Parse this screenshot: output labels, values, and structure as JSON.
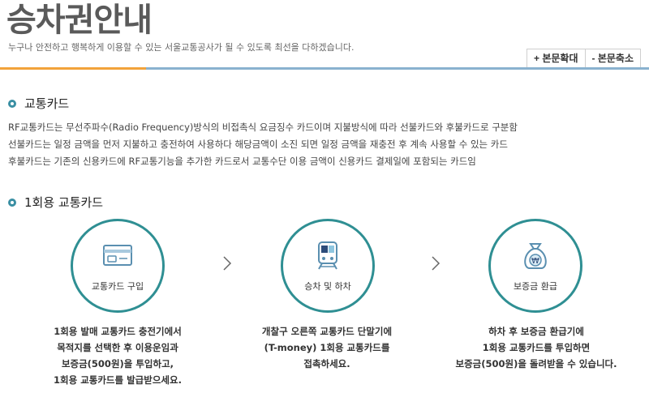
{
  "header": {
    "title": "승차권안내",
    "subtitle": "누구나 안전하고 행복하게 이용할 수 있는 서울교통공사가 될 수 있도록 최선을 다하겠습니다.",
    "zoom_in_label": "+ 본문확대",
    "zoom_out_label": "- 본문축소"
  },
  "section1": {
    "title": "교통카드",
    "lines": [
      "RF교통카드는 무선주파수(Radio Frequency)방식의 비접촉식 요금징수 카드이며 지불방식에 따라 선불카드와 후불카드로 구분함",
      "선불카드는 일정 금액을 먼저 지불하고 충전하여 사용하다 해당금액이 소진 되면 일정 금액을 재충전 후 계속 사용할 수 있는 카드",
      "후불카드는 기존의 신용카드에 RF교통기능을 추가한 카드로서 교통수단 이용 금액이 신용카드 결제일에 포함되는 카드임"
    ]
  },
  "section2": {
    "title": "1회용 교통카드",
    "steps": [
      {
        "label": "교통카드 구입",
        "icon": "card-icon",
        "desc": [
          "1회용 발매 교통카드 충전기에서",
          "목적지를 선택한 후 이용운임과",
          "보증금(500원)을 투입하고,",
          "1회용 교통카드를 발급받으세요."
        ]
      },
      {
        "label": "승차 및 하차",
        "icon": "train-icon",
        "desc": [
          "개찰구 오른쪽 교통카드 단말기에",
          "(T-money) 1회용 교통카드를",
          "접촉하세요."
        ]
      },
      {
        "label": "보증금 환급",
        "icon": "money-bag-icon",
        "desc": [
          "하차 후 보증금 환급기에",
          "1회용 교통카드를 투입하면",
          "보증금(500원)을 돌려받을 수 있습니다."
        ]
      }
    ]
  },
  "colors": {
    "accent_orange": "#f2a33a",
    "bar_blue": "#8ab2cf",
    "teal": "#2f8f93"
  }
}
